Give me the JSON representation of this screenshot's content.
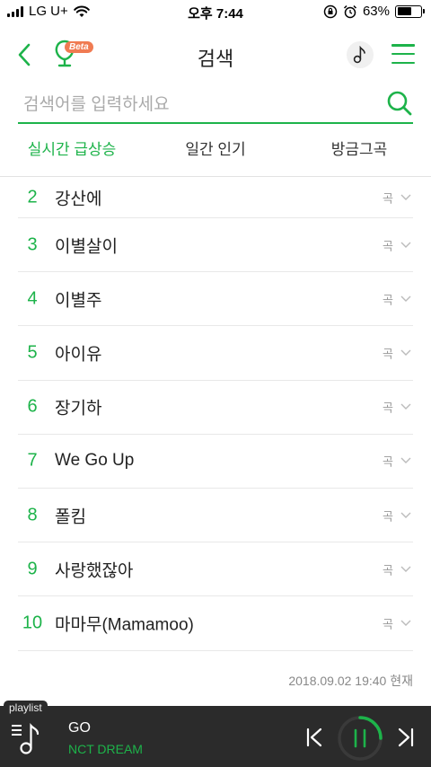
{
  "status_bar": {
    "carrier": "LG U+",
    "time": "오후 7:44",
    "battery": "63%",
    "battery_level": 0.63
  },
  "header": {
    "title": "검색",
    "beta_label": "Beta"
  },
  "search": {
    "placeholder": "검색어를 입력하세요",
    "value": ""
  },
  "tabs": [
    {
      "label": "실시간 급상승",
      "active": true
    },
    {
      "label": "일간 인기",
      "active": false
    },
    {
      "label": "방금그곡",
      "active": false
    }
  ],
  "rankings": [
    {
      "rank": "2",
      "keyword": "강산에",
      "type": "곡"
    },
    {
      "rank": "3",
      "keyword": "이별살이",
      "type": "곡"
    },
    {
      "rank": "4",
      "keyword": "이별주",
      "type": "곡"
    },
    {
      "rank": "5",
      "keyword": "아이유",
      "type": "곡"
    },
    {
      "rank": "6",
      "keyword": "장기하",
      "type": "곡"
    },
    {
      "rank": "7",
      "keyword": "We Go Up",
      "type": "곡"
    },
    {
      "rank": "8",
      "keyword": "폴킴",
      "type": "곡"
    },
    {
      "rank": "9",
      "keyword": "사랑했잖아",
      "type": "곡"
    },
    {
      "rank": "10",
      "keyword": "마마무(Mamamoo)",
      "type": "곡"
    }
  ],
  "timestamp": "2018.09.02 19:40 현재",
  "player": {
    "playlist_label": "playlist",
    "song_title": "GO",
    "artist": "NCT DREAM"
  },
  "colors": {
    "accent": "#1db34a",
    "beta_badge": "#f07b52",
    "player_bg": "#2b2b2b"
  }
}
